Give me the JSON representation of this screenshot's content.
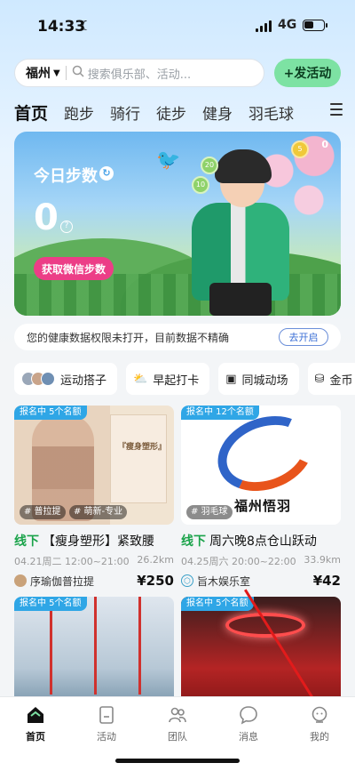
{
  "status_bar": {
    "time": "14:33",
    "network": "4G"
  },
  "search": {
    "city": "福州",
    "placeholder": "搜索俱乐部、活动..."
  },
  "post_button": "+发活动",
  "tabs": [
    "首页",
    "跑步",
    "骑行",
    "徒步",
    "健身",
    "羽毛球"
  ],
  "banner": {
    "steps_title": "今日步数",
    "steps_value": "0",
    "wechat_button": "获取微信步数",
    "coin_count": "0",
    "coins": [
      "20",
      "10",
      "5"
    ]
  },
  "notice": {
    "text": "您的健康数据权限未打开，目前数据不精确",
    "button": "去开启"
  },
  "chips": [
    {
      "label": "运动搭子"
    },
    {
      "label": "早起打卡"
    },
    {
      "label": "同城动场"
    },
    {
      "label": "金币"
    }
  ],
  "cards": [
    {
      "badge": "报名中 5个名额",
      "tags": [
        "# 普拉提",
        "# 萌新-专业"
      ],
      "mode": "线下",
      "title": "【瘦身塑形】紧致腰",
      "date": "04.21周二 12:00~21:00",
      "distance": "26.2km",
      "org": "序瑜伽普拉提",
      "price": "¥250",
      "poster_text": "『瘦身塑形』"
    },
    {
      "badge": "报名中 12个名额",
      "tags": [
        "# 羽毛球"
      ],
      "mode": "线下",
      "title": "周六晚8点仓山跃动",
      "date": "04.25周六 20:00~22:00",
      "distance": "33.9km",
      "org": "旨木娱乐室",
      "price": "¥42",
      "logo_text": "福州悟羽"
    },
    {
      "badge": "报名中 5个名额"
    },
    {
      "badge": "报名中 5个名额"
    }
  ],
  "nav": [
    {
      "label": "首页",
      "icon": "home-icon"
    },
    {
      "label": "活动",
      "icon": "activity-icon"
    },
    {
      "label": "团队",
      "icon": "team-icon"
    },
    {
      "label": "消息",
      "icon": "message-icon"
    },
    {
      "label": "我的",
      "icon": "profile-icon"
    }
  ],
  "colors": {
    "accent_green": "#7de2a3",
    "offline_green": "#1aa34a",
    "badge_blue": "#2fa6e6",
    "pink": "#ec3e87",
    "annotation_red": "#e21b1b"
  }
}
